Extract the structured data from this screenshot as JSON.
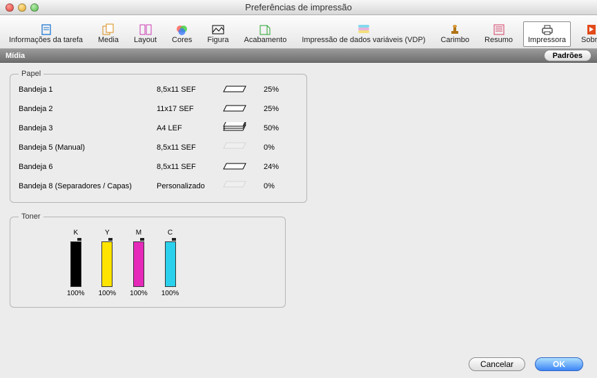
{
  "window": {
    "title": "Preferências de impressão"
  },
  "toolbar": {
    "items": [
      {
        "id": "info",
        "label": "Informações da tarefa",
        "selected": false,
        "color": "#1874d1"
      },
      {
        "id": "media",
        "label": "Media",
        "selected": false,
        "color": "#d98b16"
      },
      {
        "id": "layout",
        "label": "Layout",
        "selected": false,
        "color": "#cc3ab3"
      },
      {
        "id": "cores",
        "label": "Cores",
        "selected": false,
        "color": "#e0443e"
      },
      {
        "id": "figura",
        "label": "Figura",
        "selected": false,
        "color": "#222"
      },
      {
        "id": "acab",
        "label": "Acabamento",
        "selected": false,
        "color": "#27a32d"
      },
      {
        "id": "vdp",
        "label": "Impressão de dados variáveis (VDP)",
        "selected": false,
        "color": "#d33aad"
      },
      {
        "id": "carimbo",
        "label": "Carimbo",
        "selected": false,
        "color": "#b07316"
      },
      {
        "id": "resumo",
        "label": "Resumo",
        "selected": false,
        "color": "#d13a62"
      },
      {
        "id": "impress",
        "label": "Impressora",
        "selected": true,
        "color": "#444"
      },
      {
        "id": "sobre",
        "label": "Sobre",
        "selected": false,
        "color": "#e24a1a"
      }
    ]
  },
  "section": {
    "title": "Mídia",
    "defaults_label": "Padrões"
  },
  "paper": {
    "legend": "Papel",
    "trays": [
      {
        "name": "Bandeja 1",
        "size": "8,5x11 SEF",
        "level": "25%",
        "stack": 1
      },
      {
        "name": "Bandeja 2",
        "size": "11x17 SEF",
        "level": "25%",
        "stack": 1
      },
      {
        "name": "Bandeja 3",
        "size": "A4 LEF",
        "level": "50%",
        "stack": 3
      },
      {
        "name": "Bandeja 5 (Manual)",
        "size": "8,5x11 SEF",
        "level": "0%",
        "stack": 0
      },
      {
        "name": "Bandeja  6",
        "size": "8,5x11 SEF",
        "level": "24%",
        "stack": 1
      },
      {
        "name": "Bandeja 8 (Separadores / Capas)",
        "size": "Personalizado",
        "level": "0%",
        "stack": 0
      }
    ]
  },
  "toner": {
    "legend": "Toner",
    "items": [
      {
        "label": "K",
        "value": "100%",
        "color": "#000000"
      },
      {
        "label": "Y",
        "value": "100%",
        "color": "#ffe400"
      },
      {
        "label": "M",
        "value": "100%",
        "color": "#e52aba"
      },
      {
        "label": "C",
        "value": "100%",
        "color": "#2bd1ec"
      }
    ]
  },
  "footer": {
    "cancel": "Cancelar",
    "ok": "OK"
  }
}
